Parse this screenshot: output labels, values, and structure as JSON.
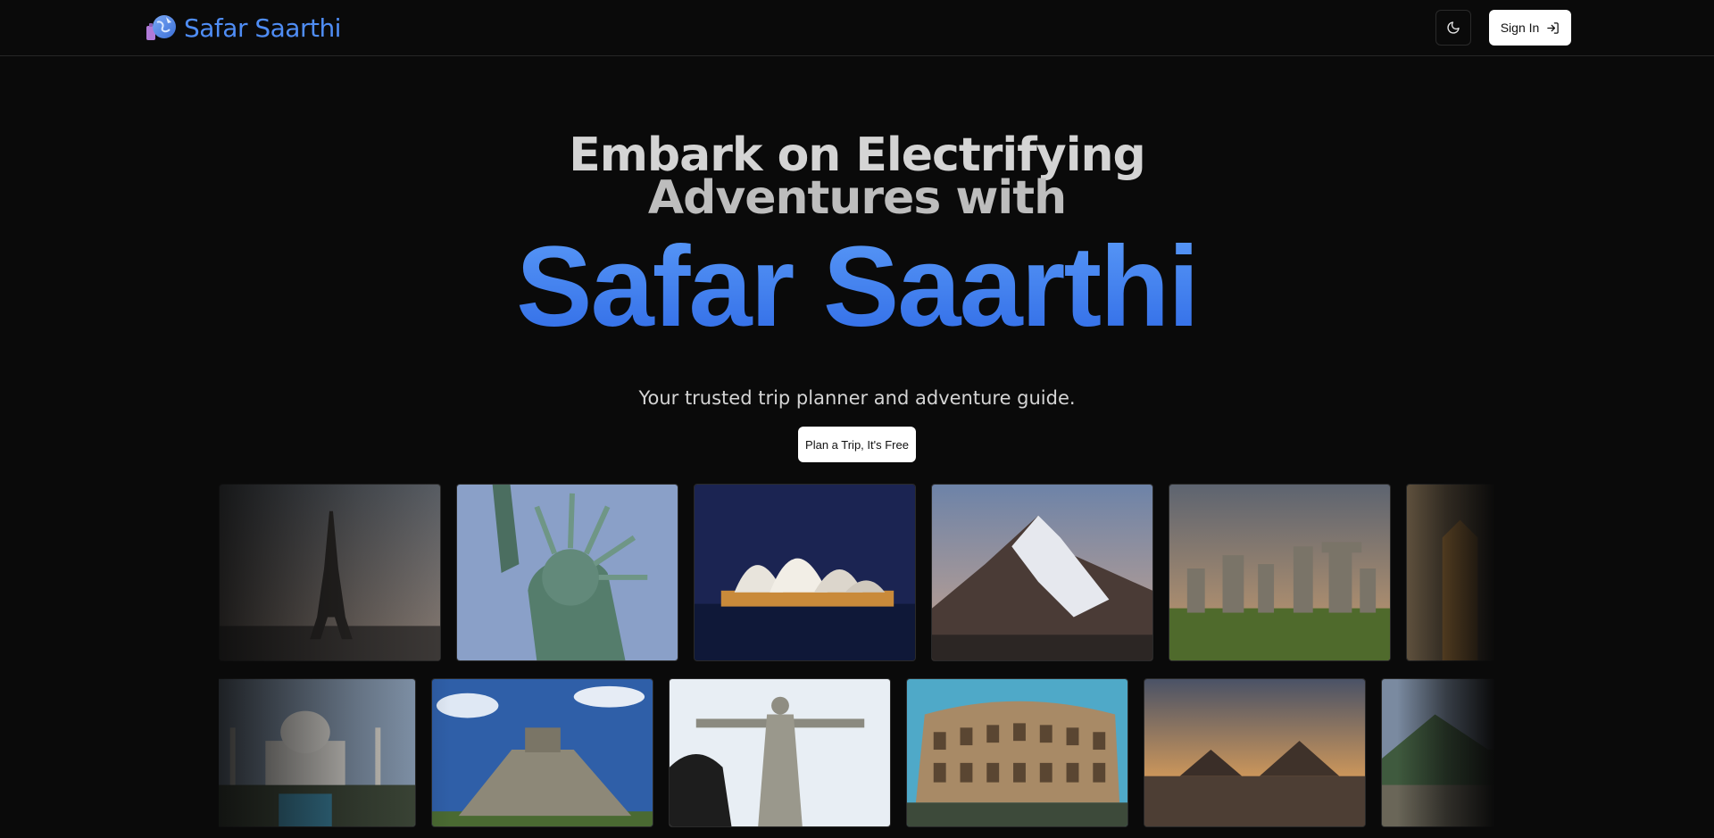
{
  "nav": {
    "brand": "Safar Saarthi",
    "theme_icon": "moon-icon",
    "signin_label": "Sign In",
    "signin_icon": "sign-in-icon"
  },
  "hero": {
    "line1": "Embark on Electrifying",
    "line2": "Adventures with",
    "brand": "Safar Saarthi",
    "tagline": "Your trusted trip planner and adventure guide.",
    "cta_label": "Plan a Trip, It's Free"
  },
  "colors": {
    "accent": "#4f8df5",
    "background": "#0a0a0a"
  },
  "gallery": {
    "row1": [
      "eiffel-tower-image",
      "statue-of-liberty-image",
      "sydney-opera-house-image",
      "mount-everest-image",
      "stonehenge-image",
      "temple-image"
    ],
    "row2": [
      "taj-mahal-image",
      "chichen-itza-image",
      "christ-the-redeemer-image",
      "colosseum-image",
      "pyramids-of-giza-image",
      "machu-picchu-image"
    ]
  }
}
